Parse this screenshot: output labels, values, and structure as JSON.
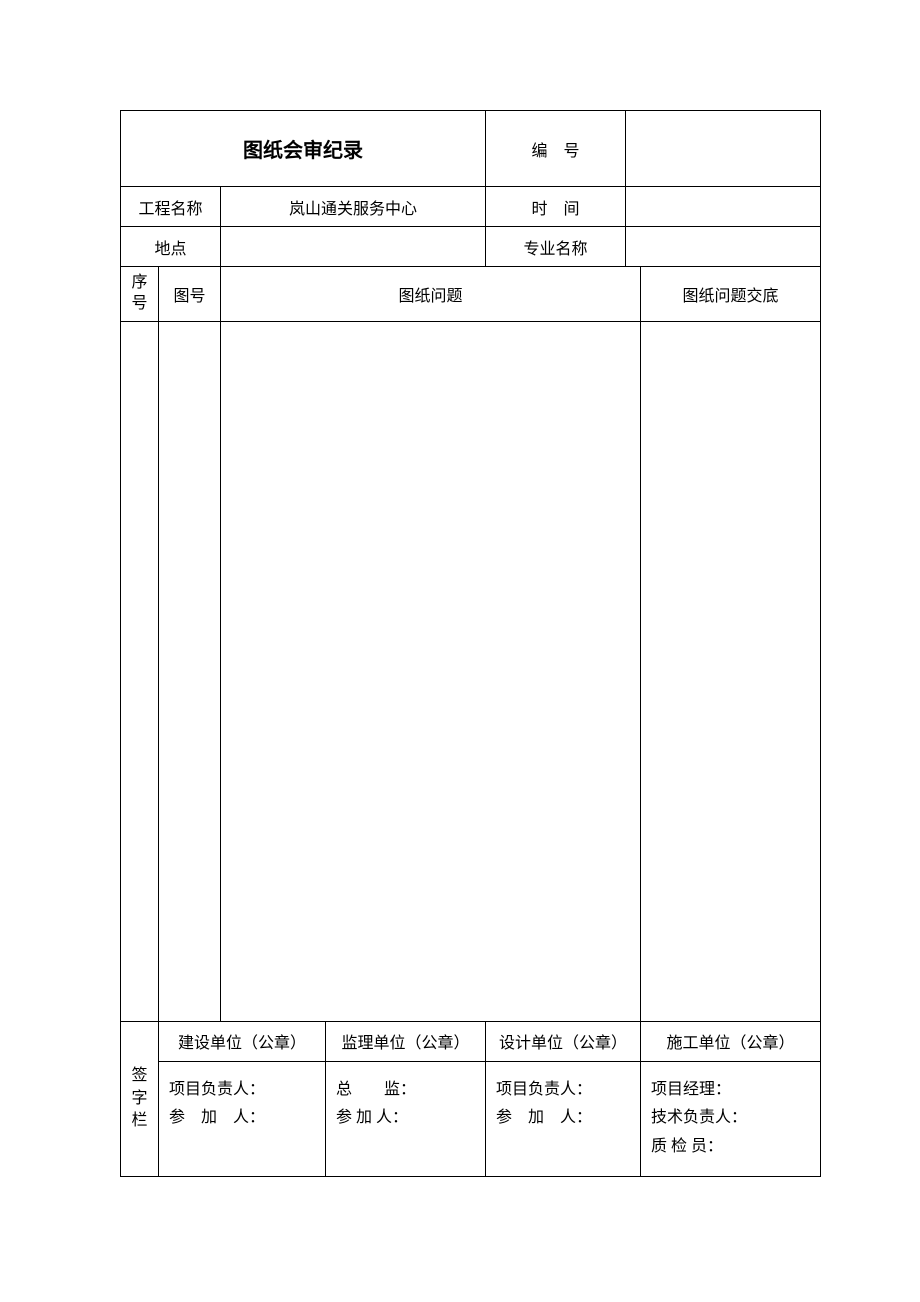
{
  "title": "图纸会审纪录",
  "labels": {
    "serialNumber": "编　号",
    "projectName": "工程名称",
    "time": "时　间",
    "location": "地点",
    "specialtyName": "专业名称",
    "seq": "序号",
    "drawingNo": "图号",
    "drawingIssue": "图纸问题",
    "drawingIssueDisclosure": "图纸问题交底",
    "signatureColumn": "签字栏"
  },
  "values": {
    "serialNumber": "",
    "projectName": "岚山通关服务中心",
    "time": "",
    "location": "",
    "specialtyName": ""
  },
  "signatures": {
    "construction": {
      "header": "建设单位（公章）",
      "lines": [
        "项目负责人：",
        "参　加　人："
      ]
    },
    "supervision": {
      "header": "监理单位（公章）",
      "lines": [
        "总　　监：",
        "参 加 人："
      ]
    },
    "design": {
      "header": "设计单位（公章）",
      "lines": [
        "项目负责人：",
        "参　加　人："
      ]
    },
    "contractor": {
      "header": "施工单位（公章）",
      "lines": [
        "项目经理：",
        "技术负责人：",
        "质 检 员："
      ]
    }
  }
}
